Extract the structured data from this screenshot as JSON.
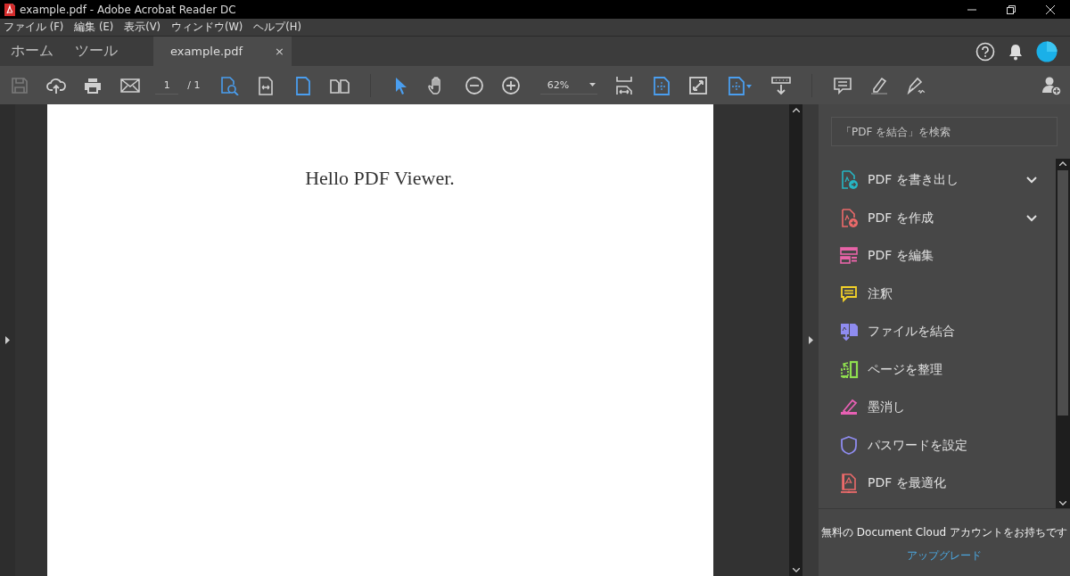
{
  "window": {
    "title": "example.pdf - Adobe Acrobat Reader DC"
  },
  "menu": [
    "ファイル (F)",
    "編集 (E)",
    "表示(V)",
    "ウィンドウ(W)",
    "ヘルプ(H)"
  ],
  "tabs": [
    {
      "label": "ホーム",
      "selected": false
    },
    {
      "label": "ツール",
      "selected": false
    },
    {
      "label": "example.pdf",
      "selected": true,
      "close": "×"
    }
  ],
  "toolbar": {
    "page_number": "1",
    "page_total": "/ 1",
    "zoom": "62%"
  },
  "document": {
    "text": "Hello PDF Viewer."
  },
  "tools_panel": {
    "search": {
      "placeholder": "「PDF を結合」を検索"
    },
    "items": [
      {
        "label": "PDF を書き出し",
        "color": "#26b6c4",
        "has_submenu": true
      },
      {
        "label": "PDF を作成",
        "color": "#ec6a6a",
        "has_submenu": true
      },
      {
        "label": "PDF を編集",
        "color": "#e864a8",
        "has_submenu": false
      },
      {
        "label": "注釈",
        "color": "#f5d328",
        "has_submenu": false
      },
      {
        "label": "ファイルを結合",
        "color": "#8f8cf0",
        "has_submenu": false
      },
      {
        "label": "ページを整理",
        "color": "#8fe04f",
        "has_submenu": false
      },
      {
        "label": "墨消し",
        "color": "#e860b4",
        "has_submenu": false
      },
      {
        "label": "パスワードを設定",
        "color": "#8f8cf0",
        "has_submenu": false
      },
      {
        "label": "PDF を最適化",
        "color": "#ec6a6a",
        "has_submenu": false
      }
    ],
    "promo": "無料の Document Cloud アカウントをお持ちです",
    "upgrade": "アップグレード"
  }
}
